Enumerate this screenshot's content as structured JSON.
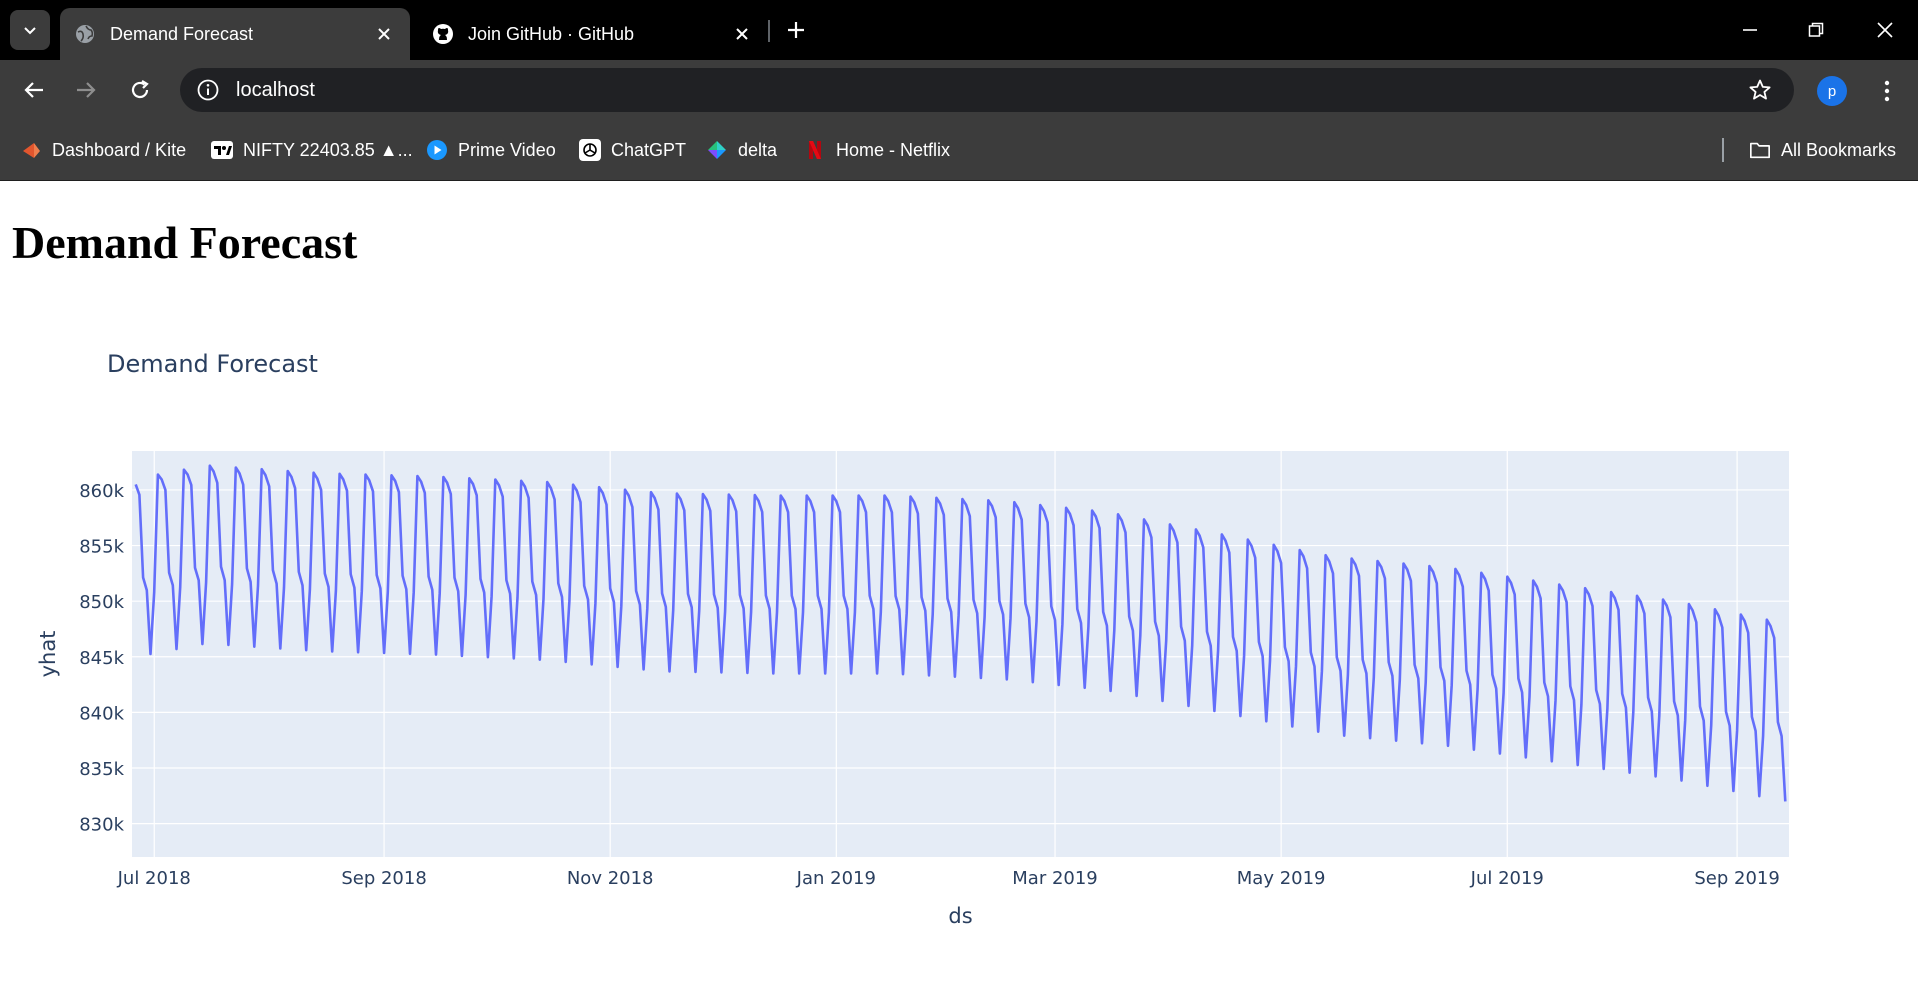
{
  "browser": {
    "tabs": [
      {
        "title": "Demand Forecast",
        "active": true,
        "icon": "globe-icon"
      },
      {
        "title": "Join GitHub · GitHub",
        "active": false,
        "icon": "github-icon"
      }
    ],
    "url": "localhost",
    "profile_initial": "p",
    "bookmarks": [
      {
        "label": "Dashboard / Kite",
        "icon": "kite-icon",
        "color": "#e2562e"
      },
      {
        "label": "NIFTY 22403.85 ▲...",
        "icon": "tradingview-icon",
        "color": "#ffffff"
      },
      {
        "label": "Prime Video",
        "icon": "prime-video-icon",
        "color": "#1a98ff"
      },
      {
        "label": "ChatGPT",
        "icon": "chatgpt-icon",
        "color": "#ffffff"
      },
      {
        "label": "delta",
        "icon": "delta-icon",
        "color": "#27c17b"
      },
      {
        "label": "Home - Netflix",
        "icon": "netflix-icon",
        "color": "#e50914"
      }
    ],
    "all_bookmarks_label": "All Bookmarks"
  },
  "page": {
    "heading": "Demand Forecast"
  },
  "colors": {
    "plot_bg": "#e5ecf6",
    "line": "#636efa",
    "grid": "#ffffff",
    "text": "#2a3f5f"
  },
  "chart_data": {
    "type": "line",
    "title": "Demand Forecast",
    "xlabel": "ds",
    "ylabel": "yhat",
    "x_range": [
      "2018-06-25",
      "2019-09-15"
    ],
    "ylim": [
      827000,
      863500
    ],
    "x_ticks": [
      {
        "date": "2018-07-01",
        "label": "Jul 2018"
      },
      {
        "date": "2018-09-01",
        "label": "Sep 2018"
      },
      {
        "date": "2018-11-01",
        "label": "Nov 2018"
      },
      {
        "date": "2019-01-01",
        "label": "Jan 2019"
      },
      {
        "date": "2019-03-01",
        "label": "Mar 2019"
      },
      {
        "date": "2019-05-01",
        "label": "May 2019"
      },
      {
        "date": "2019-07-01",
        "label": "Jul 2019"
      },
      {
        "date": "2019-09-01",
        "label": "Sep 2019"
      }
    ],
    "y_ticks": [
      {
        "value": 830000,
        "label": "830k"
      },
      {
        "value": 835000,
        "label": "835k"
      },
      {
        "value": 840000,
        "label": "840k"
      },
      {
        "value": 845000,
        "label": "845k"
      },
      {
        "value": 850000,
        "label": "850k"
      },
      {
        "value": 855000,
        "label": "855k"
      },
      {
        "value": 860000,
        "label": "860k"
      }
    ],
    "grid": true,
    "legend": false,
    "series": [
      {
        "start_date": "2018-06-26",
        "weekly_pattern_dow0_monday": [
          861000,
          860500,
          859500,
          852000,
          850800,
          845000,
          850500
        ],
        "yearly_adjustment": [
          {
            "date": "2018-06-26",
            "offset": 0
          },
          {
            "date": "2018-07-15",
            "offset": 1200
          },
          {
            "date": "2018-08-15",
            "offset": 500
          },
          {
            "date": "2018-09-15",
            "offset": 200
          },
          {
            "date": "2018-10-15",
            "offset": -300
          },
          {
            "date": "2018-11-15",
            "offset": -1300
          },
          {
            "date": "2018-12-15",
            "offset": -1500
          },
          {
            "date": "2019-01-15",
            "offset": -1500
          },
          {
            "date": "2019-02-15",
            "offset": -2000
          },
          {
            "date": "2019-03-15",
            "offset": -3000
          },
          {
            "date": "2019-04-15",
            "offset": -5000
          },
          {
            "date": "2019-05-15",
            "offset": -7000
          },
          {
            "date": "2019-06-15",
            "offset": -8000
          },
          {
            "date": "2019-07-15",
            "offset": -9500
          },
          {
            "date": "2019-08-15",
            "offset": -11000
          },
          {
            "date": "2019-09-14",
            "offset": -13000
          }
        ],
        "end_date": "2019-09-14"
      }
    ]
  }
}
